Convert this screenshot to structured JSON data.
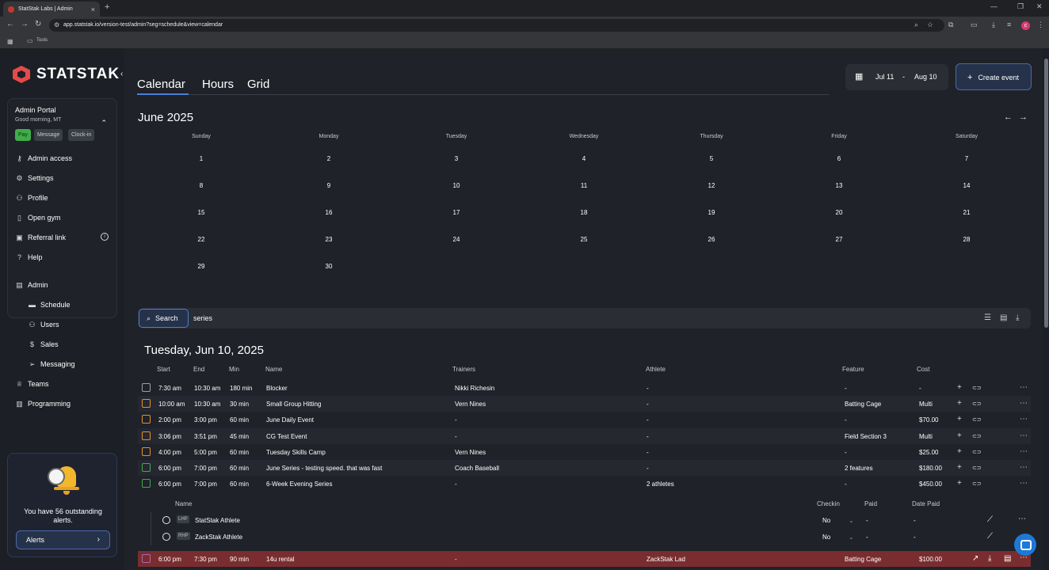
{
  "browser": {
    "tab_title": "StatStak Labs | Admin",
    "url": "app.statstak.io/version-test/admin?seg=schedule&view=calendar",
    "bookmark_folder": "Tools",
    "profile_initial": "c"
  },
  "sidebar": {
    "brand": "STATSTAK",
    "portal": {
      "title": "Admin Portal",
      "greeting": "Good morning, MT",
      "pay_label": "Pay",
      "message_label": "Message",
      "clockin_label": "Clock-in"
    },
    "portal_items": [
      {
        "label": "Admin access",
        "icon": "key-icon"
      },
      {
        "label": "Settings",
        "icon": "gear-icon"
      },
      {
        "label": "Profile",
        "icon": "user-icon"
      },
      {
        "label": "Open gym",
        "icon": "door-icon"
      },
      {
        "label": "Referral link",
        "icon": "gift-icon"
      },
      {
        "label": "Help",
        "icon": "help-icon"
      }
    ],
    "admin_label": "Admin",
    "admin_items": [
      {
        "label": "Schedule",
        "icon": "calendar-icon"
      },
      {
        "label": "Users",
        "icon": "users-icon"
      },
      {
        "label": "Sales",
        "icon": "dollar-icon"
      },
      {
        "label": "Messaging",
        "icon": "send-icon"
      }
    ],
    "teams_label": "Teams",
    "programming_label": "Programming",
    "alerts": {
      "message": "You have 56 outstanding alerts.",
      "button_label": "Alerts"
    }
  },
  "header": {
    "tabs": [
      "Calendar",
      "Hours",
      "Grid"
    ],
    "active_tab": "Calendar",
    "date_from": "Jul 11",
    "date_sep": "-",
    "date_to": "Aug 10",
    "create_label": "Create event"
  },
  "calendar": {
    "month_label": "June 2025",
    "weekdays": [
      "Sunday",
      "Monday",
      "Tuesday",
      "Wednesday",
      "Thursday",
      "Friday",
      "Saturday"
    ],
    "weeks": [
      [
        "1",
        "2",
        "3",
        "4",
        "5",
        "6",
        "7"
      ],
      [
        "8",
        "9",
        "10",
        "11",
        "12",
        "13",
        "14"
      ],
      [
        "15",
        "16",
        "17",
        "18",
        "19",
        "20",
        "21"
      ],
      [
        "22",
        "23",
        "24",
        "25",
        "26",
        "27",
        "28"
      ],
      [
        "29",
        "30",
        "",
        "",
        "",
        "",
        ""
      ]
    ]
  },
  "search": {
    "button_label": "Search",
    "value": "series"
  },
  "events": {
    "day_title": "Tuesday, Jun 10, 2025",
    "columns": [
      "Start",
      "End",
      "Min",
      "Name",
      "Trainers",
      "Athlete",
      "Feature",
      "Cost"
    ],
    "rows": [
      {
        "start": "7:30 am",
        "end": "10:30 am",
        "min": "180 min",
        "name": "Blocker",
        "trainers": "Nikki Richesin",
        "athlete": "-",
        "feature": "-",
        "cost": "-",
        "color": "#9aa0a8"
      },
      {
        "start": "10:00 am",
        "end": "10:30 am",
        "min": "30 min",
        "name": "Small Group Hitting",
        "trainers": "Vern Nines",
        "athlete": "-",
        "feature": "Batting Cage",
        "cost": "Multi",
        "color": "#e8912b"
      },
      {
        "start": "2:00 pm",
        "end": "3:00 pm",
        "min": "60 min",
        "name": "June Daily Event",
        "trainers": "-",
        "athlete": "-",
        "feature": "-",
        "cost": "$70.00",
        "color": "#e8912b"
      },
      {
        "start": "3:06 pm",
        "end": "3:51 pm",
        "min": "45 min",
        "name": "CG Test Event",
        "trainers": "-",
        "athlete": "-",
        "feature": "Field Section 3",
        "cost": "Multi",
        "color": "#e8912b"
      },
      {
        "start": "4:00 pm",
        "end": "5:00 pm",
        "min": "60 min",
        "name": "Tuesday Skills Camp",
        "trainers": "Vern Nines",
        "athlete": "-",
        "feature": "-",
        "cost": "$25.00",
        "color": "#e8912b"
      },
      {
        "start": "6:00 pm",
        "end": "7:00 pm",
        "min": "60 min",
        "name": "June Series - testing speed. that was fast",
        "trainers": "Coach Baseball",
        "athlete": "-",
        "feature": "2 features",
        "cost": "$180.00",
        "color": "#3fae49"
      },
      {
        "start": "6:00 pm",
        "end": "7:00 pm",
        "min": "60 min",
        "name": "6-Week Evening Series",
        "trainers": "-",
        "athlete": "2 athletes",
        "feature": "-",
        "cost": "$450.00",
        "color": "#3fae49"
      }
    ],
    "sub_columns": [
      "Name",
      "Checkin",
      "Paid",
      "Date Paid"
    ],
    "sub_rows": [
      {
        "tag": "LHP",
        "name": "StatStak Athlete",
        "checkin": "No",
        "paid": "-",
        "date_paid": "-"
      },
      {
        "tag": "RHP",
        "name": "ZackStak Athlete",
        "checkin": "No",
        "paid": "-",
        "date_paid": "-"
      }
    ],
    "rental": {
      "start": "6:00 pm",
      "end": "7:30 pm",
      "min": "90 min",
      "name": "14u rental",
      "trainers": "-",
      "athlete": "ZackStak Lad",
      "feature": "Batting Cage",
      "cost": "$100.00",
      "color": "#a86aa8"
    }
  }
}
